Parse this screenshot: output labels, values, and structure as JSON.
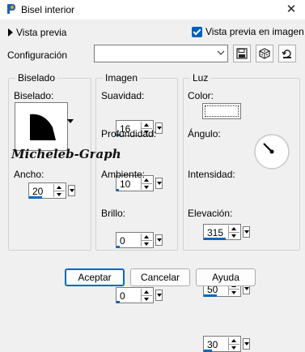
{
  "window": {
    "title": "Bisel interior"
  },
  "preview": {
    "toggle_label": "Vista previa",
    "image_preview_label": "Vista previa en imagen",
    "image_preview_checked": true
  },
  "config": {
    "label": "Configuración",
    "value": ""
  },
  "toolbar": {
    "save_icon": "save-icon",
    "random_icon": "dice-icon",
    "reset_icon": "reset-icon"
  },
  "biselado": {
    "legend": "Biselado",
    "bevel_label": "Biselado:",
    "width_label": "Ancho:",
    "width_value": "20",
    "width_fraction": 0.5
  },
  "watermark": "Micheleb-Graph",
  "imagen": {
    "legend": "Imagen",
    "suavidad_label": "Suavidad:",
    "suavidad_value": "16",
    "suavidad_fraction": 0.16,
    "profundidad_label": "Profundidad:",
    "profundidad_value": "10",
    "profundidad_fraction": 0.1,
    "ambiente_label": "Ambiente:",
    "ambiente_value": "0",
    "ambiente_fraction": 0.0,
    "brillo_label": "Brillo:",
    "brillo_value": "0",
    "brillo_fraction": 0.0
  },
  "luz": {
    "legend": "Luz",
    "color_label": "Color:",
    "color_value": "#ffffff",
    "angulo_label": "Ángulo:",
    "angulo_value": "315",
    "angulo_fraction": 0.875,
    "intensidad_label": "Intensidad:",
    "intensidad_value": "50",
    "intensidad_fraction": 0.5,
    "elevacion_label": "Elevación:",
    "elevacion_value": "30",
    "elevacion_fraction": 0.33
  },
  "buttons": {
    "ok": "Aceptar",
    "cancel": "Cancelar",
    "help": "Ayuda"
  },
  "colors": {
    "accent": "#0067c0",
    "checkbox": "#005fb8"
  }
}
